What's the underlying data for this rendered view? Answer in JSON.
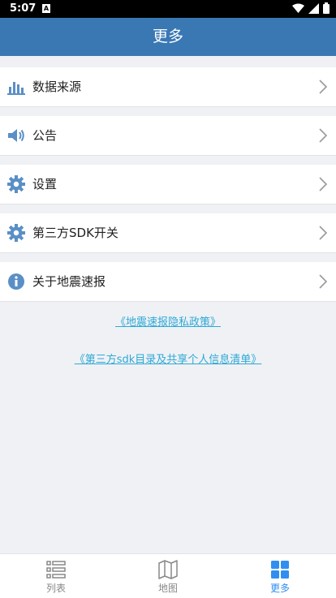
{
  "status_bar": {
    "time": "5:07",
    "badge": "A"
  },
  "header": {
    "title": "更多"
  },
  "menu": [
    {
      "label": "数据来源",
      "icon": "bar-chart-icon"
    },
    {
      "label": "公告",
      "icon": "speaker-icon"
    },
    {
      "label": "设置",
      "icon": "gear-icon"
    },
    {
      "label": "第三方SDK开关",
      "icon": "gear-icon"
    },
    {
      "label": "关于地震速报",
      "icon": "info-icon"
    }
  ],
  "links": {
    "privacy": "《地震速报隐私政策》",
    "sdk_list": "《第三方sdk目录及共享个人信息清单》"
  },
  "tabs": [
    {
      "label": "列表",
      "icon": "list-icon"
    },
    {
      "label": "地图",
      "icon": "map-icon"
    },
    {
      "label": "更多",
      "icon": "grid-icon",
      "active": true
    }
  ],
  "colors": {
    "header_bg": "#3a78b4",
    "icon_blue": "#5a8fc6",
    "active_tab": "#2f8ef0",
    "inactive_tab": "#888888",
    "link": "#2ca9d6"
  }
}
